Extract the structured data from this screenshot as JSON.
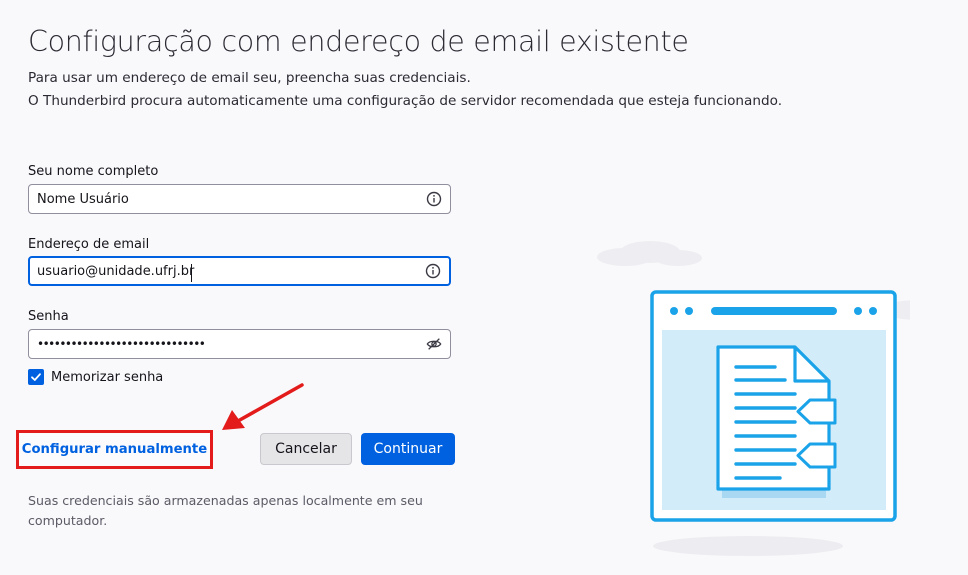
{
  "header": {
    "title": "Configuração com endereço de email existente",
    "description_line1": "Para usar um endereço de email seu, preencha suas credenciais.",
    "description_line2": "O Thunderbird procura automaticamente uma configuração de servidor recomendada que esteja funcionando."
  },
  "form": {
    "name": {
      "label": "Seu nome completo",
      "value": "Nome Usuário",
      "icon": "info-icon"
    },
    "email": {
      "label": "Endereço de email",
      "value": "usuario@unidade.ufrj.br",
      "icon": "info-icon"
    },
    "password": {
      "label": "Senha",
      "value": "••••••••••••••••••••••••••••••",
      "icon": "eye-slash-icon"
    },
    "remember": {
      "label": "Memorizar senha",
      "checked": true
    }
  },
  "buttons": {
    "manual": "Configurar manualmente",
    "cancel": "Cancelar",
    "continue": "Continuar"
  },
  "footnote": "Suas credenciais são armazenadas apenas localmente em seu computador.",
  "colors": {
    "accent": "#0061e0",
    "highlight_annotation": "#e31b1b",
    "illustration_blue": "#1aa3e8",
    "illustration_fill": "#d3ecfa"
  }
}
